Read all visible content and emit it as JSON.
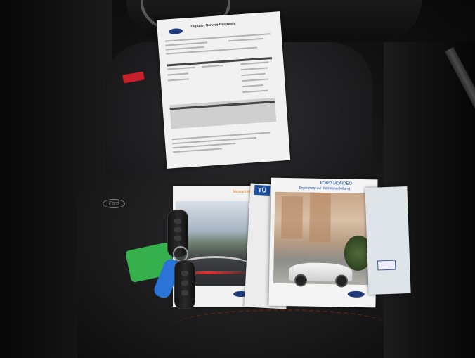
{
  "photo": {
    "description_alt": "Ford Mondeo documents and keys on a car seat",
    "service_document": {
      "title": "Digitaler Service Nachweis",
      "logo_text": "Ford"
    },
    "service_booklet": {
      "label": "Serviceheft",
      "logo_text": "Ford"
    },
    "middle_paper": {
      "tag": "TÜ"
    },
    "owner_manual": {
      "brand": "FORD MONDEO",
      "title": "Ergänzung zur Betriebsanleitung",
      "logo_text": "Ford"
    },
    "seat_logo_text": "Ford"
  }
}
